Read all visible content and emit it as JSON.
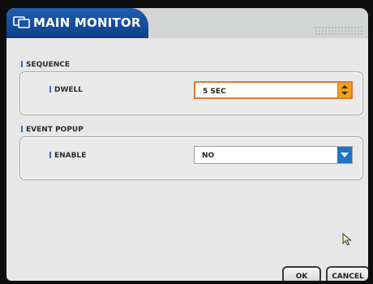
{
  "window": {
    "title": "MAIN MONITOR",
    "icon": "monitor-icon"
  },
  "sequence": {
    "section_label": "SEQUENCE",
    "dwell": {
      "label": "DWELL",
      "value": "5 SEC"
    }
  },
  "event_popup": {
    "section_label": "EVENT POPUP",
    "enable": {
      "label": "ENABLE",
      "value": "NO"
    }
  },
  "buttons": {
    "ok": "OK",
    "cancel": "CANCEL"
  },
  "colors": {
    "title_bar": "#1a56a6",
    "focus_border": "#e17832",
    "spinner": "#efa21c",
    "dropdown": "#1f72c6"
  }
}
